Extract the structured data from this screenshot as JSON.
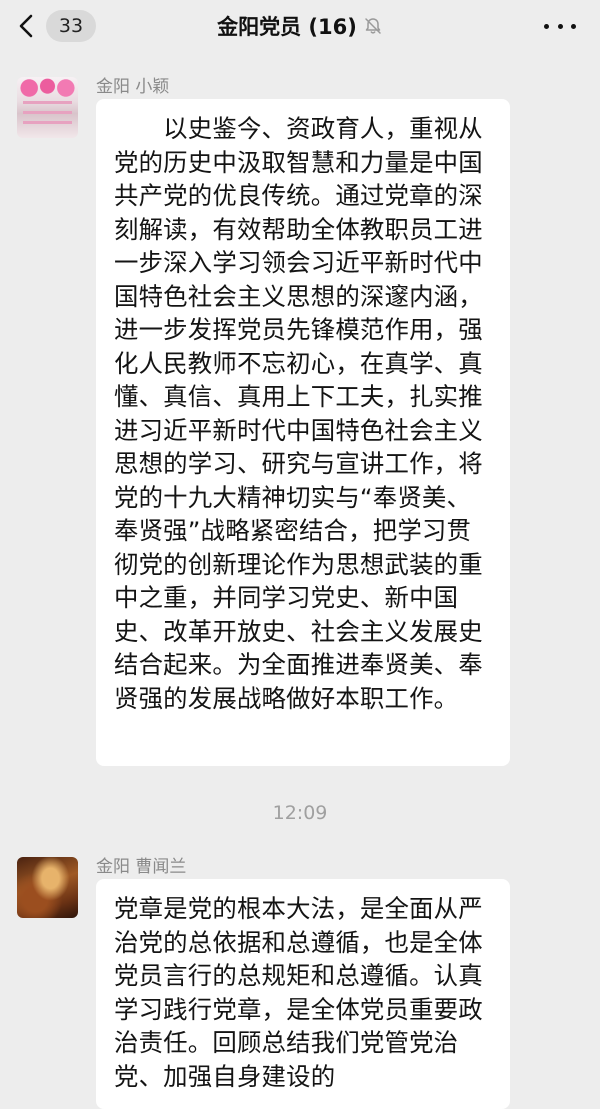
{
  "header": {
    "back_badge": "33",
    "title": "金阳党员 (16)",
    "icons": {
      "back": "chevron-left-icon",
      "mute": "bell-muted-icon",
      "more": "more-dots-icon"
    }
  },
  "messages": [
    {
      "sender": "金阳  小颖",
      "avatar": "avatar-pink-dancers",
      "text": "　　以史鉴今、资政育人，重视从党的历史中汲取智慧和力量是中国共产党的优良传统。通过党章的深刻解读，有效帮助全体教职员工进一步深入学习领会习近平新时代中国特色社会主义思想的深邃内涵，进一步发挥党员先锋模范作用，强化人民教师不忘初心，在真学、真懂、真信、真用上下工夫，扎实推进习近平新时代中国特色社会主义思想的学习、研究与宣讲工作，将党的十九大精神切实与“奉贤美、奉贤强”战略紧密结合，把学习贯彻党的创新理论作为思想武装的重中之重，并同学习党史、新中国史、改革开放史、社会主义发展史结合起来。为全面推进奉贤美、奉贤强的发展战略做好本职工作。"
    },
    {
      "timestamp": "12:09"
    },
    {
      "sender": "金阳  曹闻兰",
      "avatar": "avatar-orange-stage",
      "text": "党章是党的根本大法，是全面从严治党的总依据和总遵循，也是全体党员言行的总规矩和总遵循。认真学习践行党章，是全体党员重要政治责任。回顾总结我们党管党治党、加强自身建设的"
    }
  ],
  "colors": {
    "background": "#ededed",
    "bubble": "#ffffff",
    "sender_name": "#8a8a8a",
    "timestamp": "#a0a0a0"
  }
}
